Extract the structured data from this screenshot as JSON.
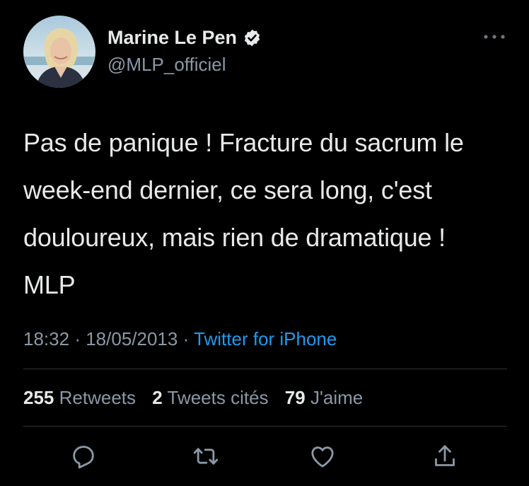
{
  "author": {
    "name": "Marine Le Pen",
    "handle": "@MLP_officiel",
    "verified_icon": "verified-badge-icon"
  },
  "tweet": {
    "text": "Pas de panique ! Fracture du sacrum le week-end dernier, ce sera long, c'est douloureux, mais rien de dramatique ! MLP",
    "time": "18:32",
    "separator": "·",
    "date": "18/05/2013",
    "source": "Twitter for iPhone"
  },
  "stats": {
    "retweets_count": "255",
    "retweets_label": "Retweets",
    "quotes_count": "2",
    "quotes_label": "Tweets cités",
    "likes_count": "79",
    "likes_label": "J'aime"
  },
  "actions": [
    "reply-icon",
    "retweet-icon",
    "like-icon",
    "share-icon"
  ],
  "colors": {
    "background": "#000000",
    "text": "#e7e9ea",
    "secondary": "#8b98a5",
    "link": "#1d9bf0",
    "divider": "#2f3336"
  }
}
